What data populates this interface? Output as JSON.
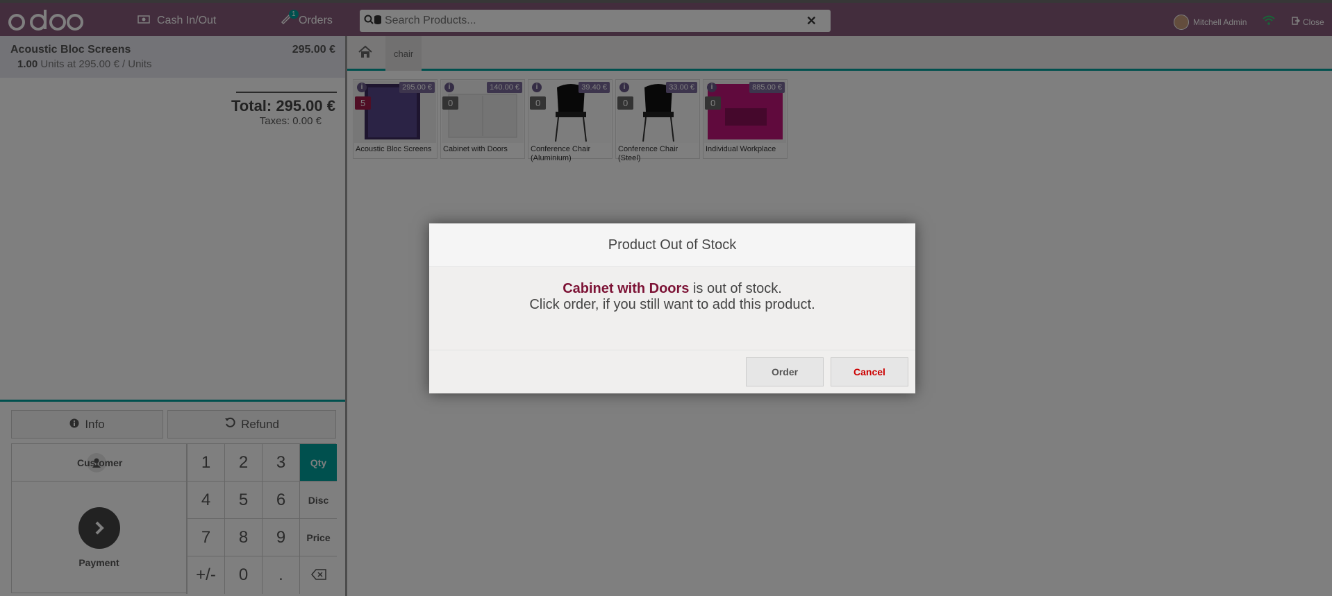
{
  "header": {
    "cash_label": "Cash In/Out",
    "orders_label": "Orders",
    "orders_count": "1",
    "search_placeholder": "Search Products...",
    "user_name": "Mitchell Admin",
    "close_label": "Close"
  },
  "order": {
    "line": {
      "name": "Acoustic Bloc Screens",
      "price": "295.00 €",
      "qty": "1.00",
      "detail": "Units at 295.00 € / Units"
    },
    "total": "Total: 295.00 €",
    "taxes": "Taxes: 0.00 €"
  },
  "controls": {
    "info_label": "Info",
    "refund_label": "Refund",
    "customer_label": "Customer",
    "payment_label": "Payment",
    "keys": [
      "1",
      "2",
      "3",
      "Qty",
      "4",
      "5",
      "6",
      "Disc",
      "7",
      "8",
      "9",
      "Price",
      "+/-",
      "0",
      "."
    ]
  },
  "breadcrumb": {
    "category": "chair"
  },
  "products": [
    {
      "name": "Acoustic Bloc Screens",
      "price": "295.00 €",
      "qty": "5"
    },
    {
      "name": "Cabinet with Doors",
      "price": "140.00 €",
      "qty": "0"
    },
    {
      "name": "Conference Chair (Aluminium)",
      "price": "39.40 €",
      "qty": "0"
    },
    {
      "name": "Conference Chair (Steel)",
      "price": "33.00 €",
      "qty": "0"
    },
    {
      "name": "Individual Workplace",
      "price": "885.00 €",
      "qty": "0"
    }
  ],
  "modal": {
    "title": "Product Out of Stock",
    "product_name": "Cabinet with Doors",
    "message_suffix": " is out of stock.",
    "message_line2": "Click order, if you still want to add this product.",
    "order_label": "Order",
    "cancel_label": "Cancel"
  },
  "colors": {
    "brand": "#875a7b",
    "accent": "#00a09d",
    "danger": "#cc0000"
  }
}
